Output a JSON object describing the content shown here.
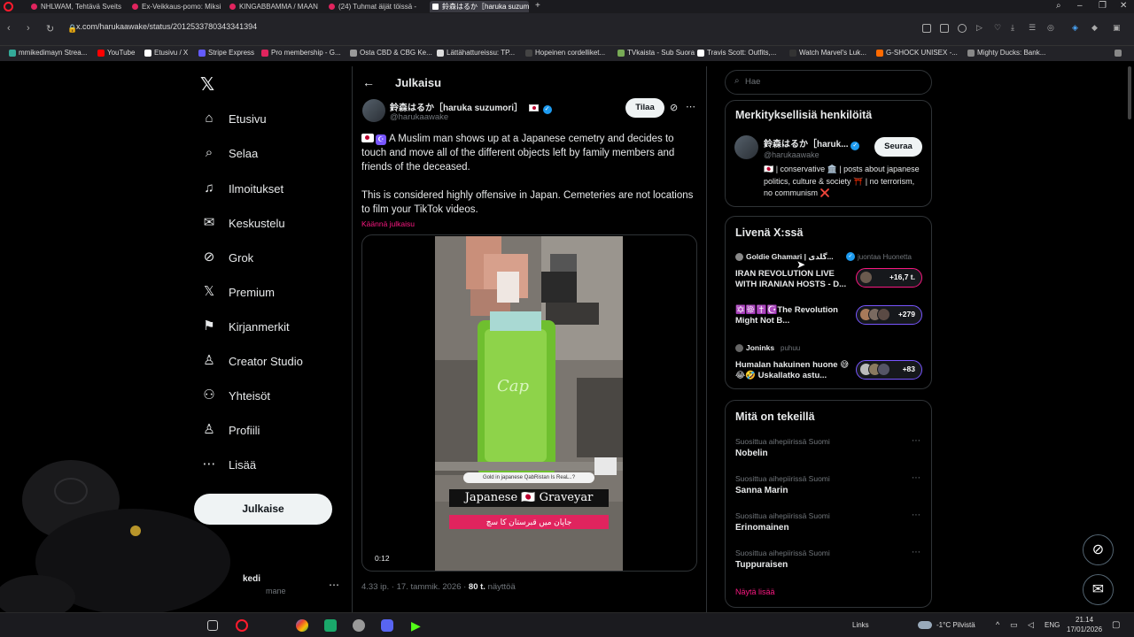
{
  "tabs": [
    {
      "label": "NHLWAM, Tehtävä Sveits"
    },
    {
      "label": "Ex-Veikkaus-pomo: Miksi"
    },
    {
      "label": "KINGABBAMMA / MAAN"
    },
    {
      "label": "(24) Tuhmat äijät töissä -"
    },
    {
      "label": "鈴森はるか［haruka suzum"
    }
  ],
  "address": {
    "url": "x.com/harukaawake/status/2012533780343341394"
  },
  "bookmarks": [
    {
      "label": "mmikedimayn Strea..."
    },
    {
      "label": "YouTube"
    },
    {
      "label": "Etusivu / X"
    },
    {
      "label": "Stripe Express"
    },
    {
      "label": "Pro membership - G..."
    },
    {
      "label": "Osta CBD & CBG Ke..."
    },
    {
      "label": "Lättähattureissu: TP..."
    },
    {
      "label": "Hopeinen cordelliket..."
    },
    {
      "label": "TVkaista - Sub Suora"
    },
    {
      "label": "Travis Scott: Outfits,..."
    },
    {
      "label": "Watch Marvel's Luk..."
    },
    {
      "label": "G-SHOCK UNISEX -..."
    },
    {
      "label": "Mighty Ducks: Bank..."
    }
  ],
  "nav": {
    "items": [
      {
        "label": "Etusivu",
        "icon": "home-icon"
      },
      {
        "label": "Selaa",
        "icon": "search-icon"
      },
      {
        "label": "Ilmoitukset",
        "icon": "bell-icon"
      },
      {
        "label": "Keskustelu",
        "icon": "mail-icon"
      },
      {
        "label": "Grok",
        "icon": "grok-icon"
      },
      {
        "label": "Premium",
        "icon": "x-icon"
      },
      {
        "label": "Kirjanmerkit",
        "icon": "bookmark-icon"
      },
      {
        "label": "Creator Studio",
        "icon": "creator-icon"
      },
      {
        "label": "Yhteisöt",
        "icon": "communities-icon"
      },
      {
        "label": "Profiili",
        "icon": "profile-icon"
      },
      {
        "label": "Lisää",
        "icon": "more-icon"
      }
    ],
    "post_button": "Julkaise",
    "account_name": "kedi",
    "account_handle": "mane"
  },
  "post": {
    "header_title": "Julkaisu",
    "author_name": "鈴森はるか［haruka suzumori］",
    "author_handle": "@harukaawake",
    "subscribe_label": "Tilaa",
    "text_p1": "A Muslim man shows up at a Japanese cemetry and decides to touch and move all of the different objects left by family members and friends of the deceased.",
    "text_p2": "This is considered highly offensive in Japan. Cemeteries are not locations to film your TikTok videos.",
    "translate_label": "Käännä julkaisu",
    "video_duration": "0:12",
    "video_caption_top": "Gold in japanese QabRistan Is ReaL..?",
    "video_caption_main": "Japanese 🇯🇵 Graveyar",
    "video_caption_bottom": "جاپان میں قبرستان کا سچ",
    "timestamp": "4.33 ip. · 17. tammik. 2026 ·",
    "views_count": "80 t.",
    "views_label": "näyttöä"
  },
  "search": {
    "placeholder": "Hae"
  },
  "relevant": {
    "title": "Merkityksellisiä henkilöitä",
    "name": "鈴森はるか［haruk...",
    "handle": "@harukaawake",
    "follow_label": "Seuraa",
    "bio": "🇯🇵 | conservative 🏛️ | posts about japanese politics, culture & society ⛩️ | no terrorism, no communism ❌"
  },
  "live": {
    "title": "Livenä X:ssä",
    "items": [
      {
        "host": "Goldie Ghamari | گلدی...",
        "status": "juontaa Huonetta",
        "title": "IRAN REVOLUTION LIVE WITH IRANIAN HOSTS - D...",
        "count": "+16,7 t."
      },
      {
        "host": "",
        "status": "",
        "title": "✡️☸️✝️☪️The Revolution Might Not B...",
        "count": "+279"
      },
      {
        "host": "Joninks",
        "status": "puhuu",
        "title": "Humalan hakuinen huone 😅😂🤣 Uskallatko astu...",
        "count": "+83"
      }
    ]
  },
  "trending": {
    "title": "Mitä on tekeillä",
    "items": [
      {
        "meta": "Suosittua aihepiirissä Suomi",
        "name": "Nobelin"
      },
      {
        "meta": "Suosittua aihepiirissä Suomi",
        "name": "Sanna Marin"
      },
      {
        "meta": "Suosittua aihepiirissä Suomi",
        "name": "Erinomainen"
      },
      {
        "meta": "Suosittua aihepiirissä Suomi",
        "name": "Tuppuraisen"
      }
    ],
    "show_more": "Näytä lisää"
  },
  "taskbar": {
    "links": "Links",
    "weather": "-1°C Pilvistä",
    "lang": "ENG",
    "time": "21.14",
    "date": "17/01/2026"
  },
  "colors": {
    "accent": "#1d9bf0",
    "live_border": "#7856ff",
    "translate": "#f91880"
  }
}
